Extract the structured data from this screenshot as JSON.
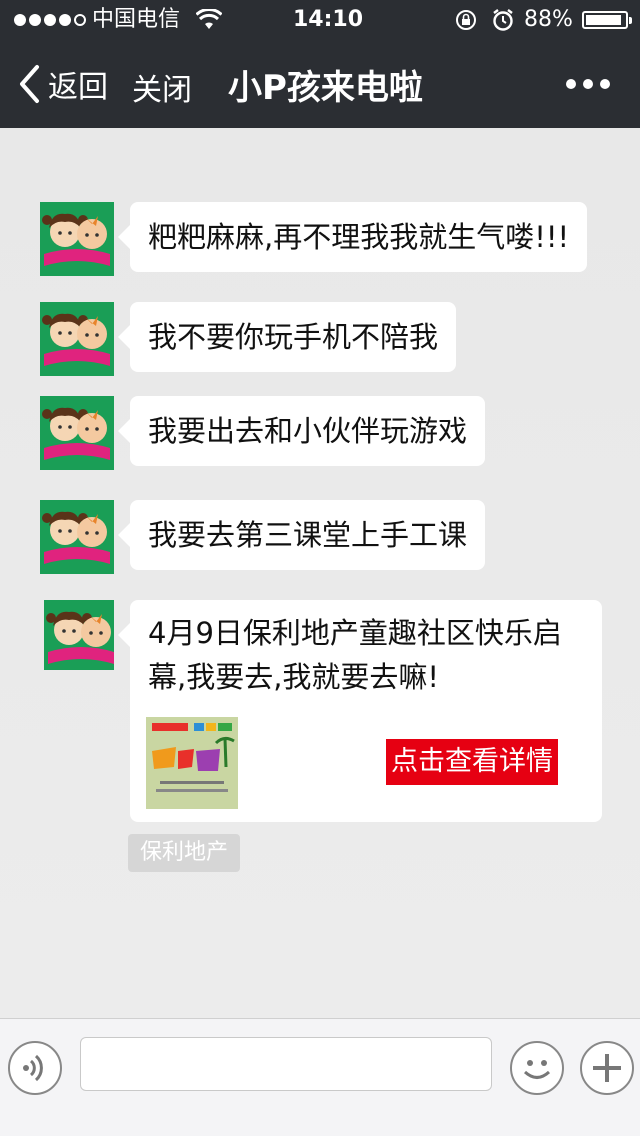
{
  "status_bar": {
    "carrier": "中国电信",
    "time": "14:10",
    "battery_percent": "88%",
    "battery_level": 0.88,
    "signal_strength": 4,
    "signal_max": 5
  },
  "nav": {
    "back_label": "返回",
    "close_label": "关闭",
    "title": "小P孩来电啦"
  },
  "messages": [
    {
      "text": "粑粑麻麻,再不理我我就生气喽!!!"
    },
    {
      "text": "我不要你玩手机不陪我"
    },
    {
      "text": "我要出去和小伙伴玩游戏"
    },
    {
      "text": "我要去第三课堂上手工课"
    }
  ],
  "card": {
    "text": "4月9日保利地产童趣社区快乐启幕,我要去,我就要去嘛!",
    "button_label": "点击查看详情",
    "button_color": "#e60012"
  },
  "source_tag": "保利地产",
  "input": {
    "value": "",
    "placeholder": ""
  },
  "colors": {
    "nav_bg": "#2b2e33",
    "avatar_bg": "#1a9e56",
    "chat_bg": "#ebebeb"
  }
}
